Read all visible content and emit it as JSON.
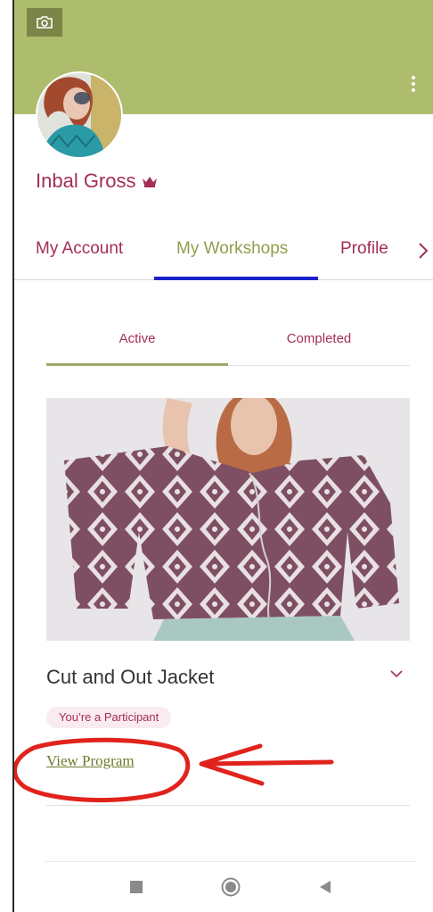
{
  "profile": {
    "name": "Inbal Gross"
  },
  "icons": {
    "camera": "camera-icon",
    "more": "more-vert-icon",
    "crown": "crown-icon",
    "chevron_right": "chevron-right-icon",
    "chevron_down": "chevron-down-icon",
    "nav_square": "square-icon",
    "nav_home": "circle-icon",
    "nav_back": "triangle-back-icon"
  },
  "main_tabs": [
    {
      "label": "My Account",
      "active": false
    },
    {
      "label": "My Workshops",
      "active": true
    },
    {
      "label": "Profile",
      "active": false
    }
  ],
  "sub_tabs": [
    {
      "label": "Active",
      "active": true
    },
    {
      "label": "Completed",
      "active": false
    }
  ],
  "workshop": {
    "title": "Cut and Out Jacket",
    "badge": "You’re a Participant",
    "link": "View Program"
  },
  "colors": {
    "cover": "#aebd6d",
    "brand": "#a32e57",
    "accent_green": "#8da050",
    "tab_indicator": "#1a22c8",
    "annotation": "#e0231c"
  }
}
